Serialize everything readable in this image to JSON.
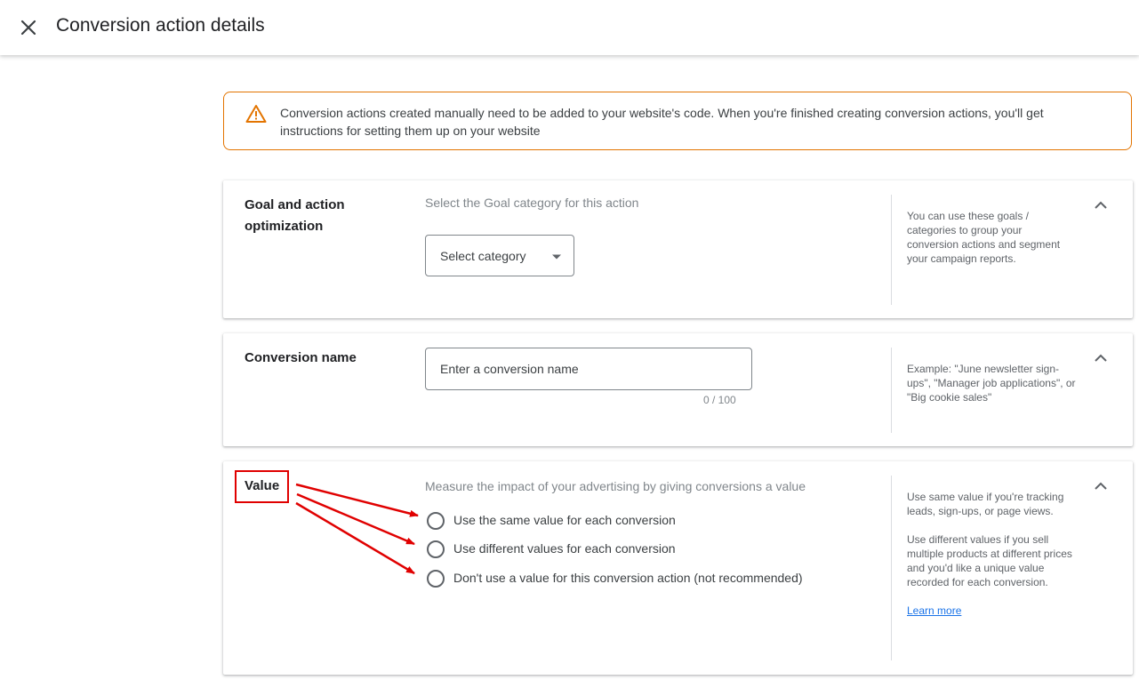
{
  "header": {
    "title": "Conversion action details",
    "close_icon": "close-icon"
  },
  "alert": {
    "icon": "warning-icon",
    "text": "Conversion actions created manually need to be added to your website's code. When you're finished creating conversion actions, you'll get instructions for setting them up on your website",
    "border_color": "#e37400"
  },
  "goal_section": {
    "title": "Goal and action optimization",
    "hint": "Select the Goal category for this action",
    "select_label": "Select category",
    "help_text": "You can use these goals / categories to group your conversion actions and segment your campaign reports."
  },
  "name_section": {
    "title": "Conversion name",
    "input_placeholder": "Enter a conversion name",
    "input_value": "",
    "counter": "0 / 100",
    "help_text": "Example: \"June newsletter sign-ups\", \"Manager job applications\", or \"Big cookie sales\""
  },
  "value_section": {
    "title": "Value",
    "hint": "Measure the impact of your advertising by giving conversions a value",
    "options": [
      {
        "label": "Use the same value for each conversion",
        "selected": false
      },
      {
        "label": "Use different values for each conversion",
        "selected": false
      },
      {
        "label": "Don't use a value for this conversion action (not recommended)",
        "selected": false
      }
    ],
    "help_text_1": "Use same value if you're tracking leads, sign-ups, or page views.",
    "help_text_2": "Use different values if you sell multiple products at different prices and you'd like a unique value recorded for each conversion.",
    "learn_more": "Learn more"
  },
  "annotation": {
    "color": "#e00000"
  }
}
